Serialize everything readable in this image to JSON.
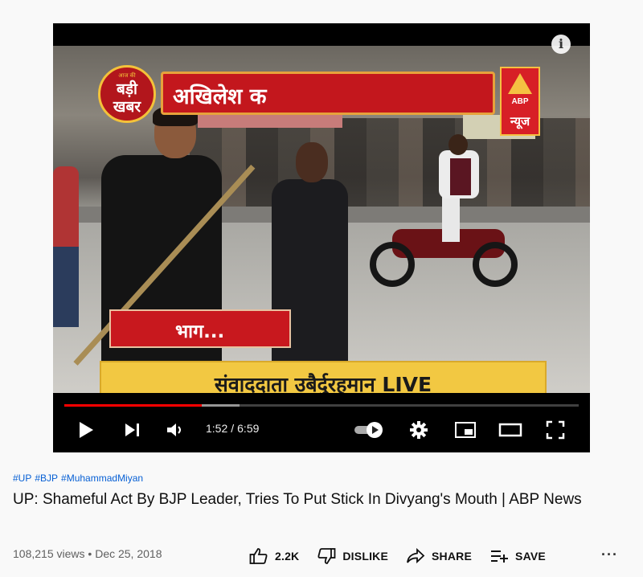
{
  "video": {
    "overlay": {
      "badi_khabar_small": "आज की",
      "badi_khabar": "बड़ी खबर",
      "headline": "अखिलेश क",
      "abp_logo_text": "ABP",
      "abp_news_hindi": "न्यूज",
      "caption": "भाग...",
      "reporter_strip": "संवाददाता उबैर्दुरहमान LIVE"
    },
    "player": {
      "current_time": "1:52",
      "separator": "/",
      "duration": "6:59",
      "played_fraction": 0.267,
      "buffered_fraction": 0.34,
      "autoplay_on": true
    }
  },
  "hashtags": [
    "#UP",
    "#BJP",
    "#MuhammadMiyan"
  ],
  "title": "UP: Shameful Act By BJP Leader, Tries To Put Stick In Divyang's Mouth | ABP News",
  "views": "108,215 views",
  "dot": "•",
  "date": "Dec 25, 2018",
  "actions": {
    "like_count": "2.2K",
    "dislike_label": "DISLIKE",
    "share_label": "SHARE",
    "save_label": "SAVE",
    "more": "···"
  },
  "colors": {
    "accent": "#ff0000",
    "link": "#065fd4"
  }
}
